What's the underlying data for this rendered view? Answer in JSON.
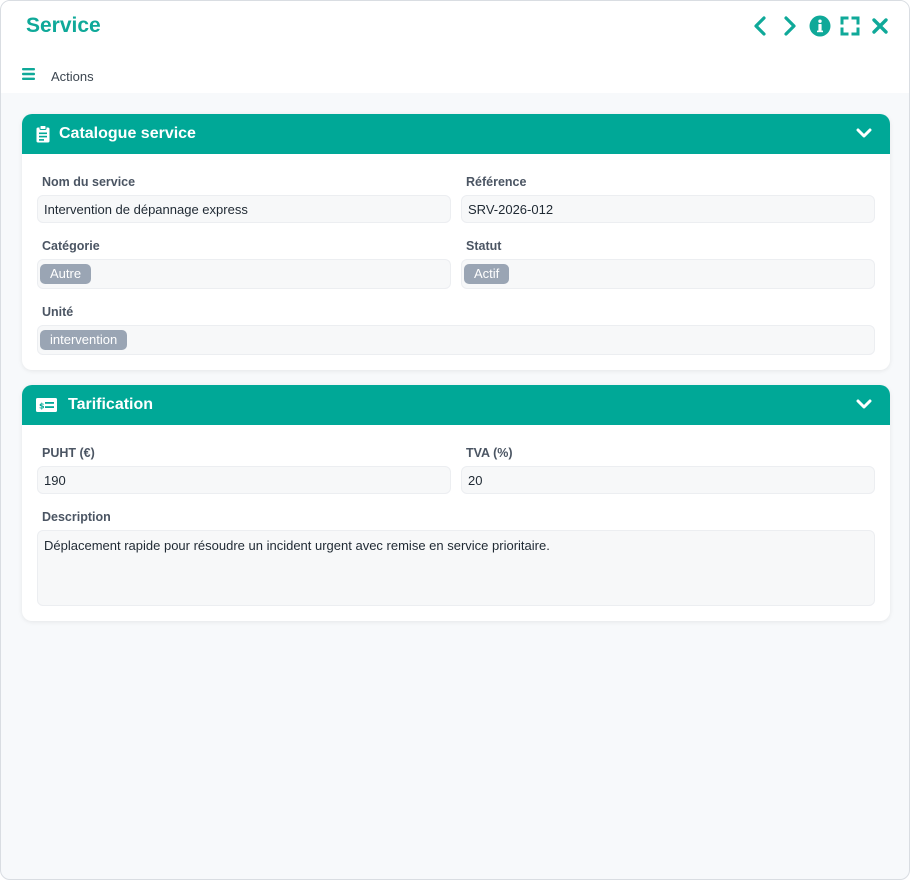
{
  "window": {
    "title": "Service",
    "controls": [
      "chevron-left-icon",
      "chevron-right-icon",
      "info-icon",
      "expand-icon",
      "close-icon"
    ]
  },
  "actions": {
    "label": "Actions"
  },
  "catalogue": {
    "title": "Catalogue service",
    "nom_label": "Nom du service",
    "nom_value": "Intervention de dépannage express",
    "reference_label": "Référence",
    "reference_value": "SRV-2026-012",
    "categorie_label": "Catégorie",
    "categorie_value": "Autre",
    "statut_label": "Statut",
    "statut_value": "Actif",
    "unite_label": "Unité",
    "unite_value": "intervention"
  },
  "tarification": {
    "title": "Tarification",
    "puht_label": "PUHT (€)",
    "puht_value": "190",
    "tva_label": "TVA (%)",
    "tva_value": "20",
    "description_label": "Description",
    "description_value": "Déplacement rapide pour résoudre un incident urgent avec remise en service prioritaire."
  },
  "colors": {
    "accent": "#00a897",
    "tag": "#9aa5b4",
    "background": "#f7f9fb"
  }
}
